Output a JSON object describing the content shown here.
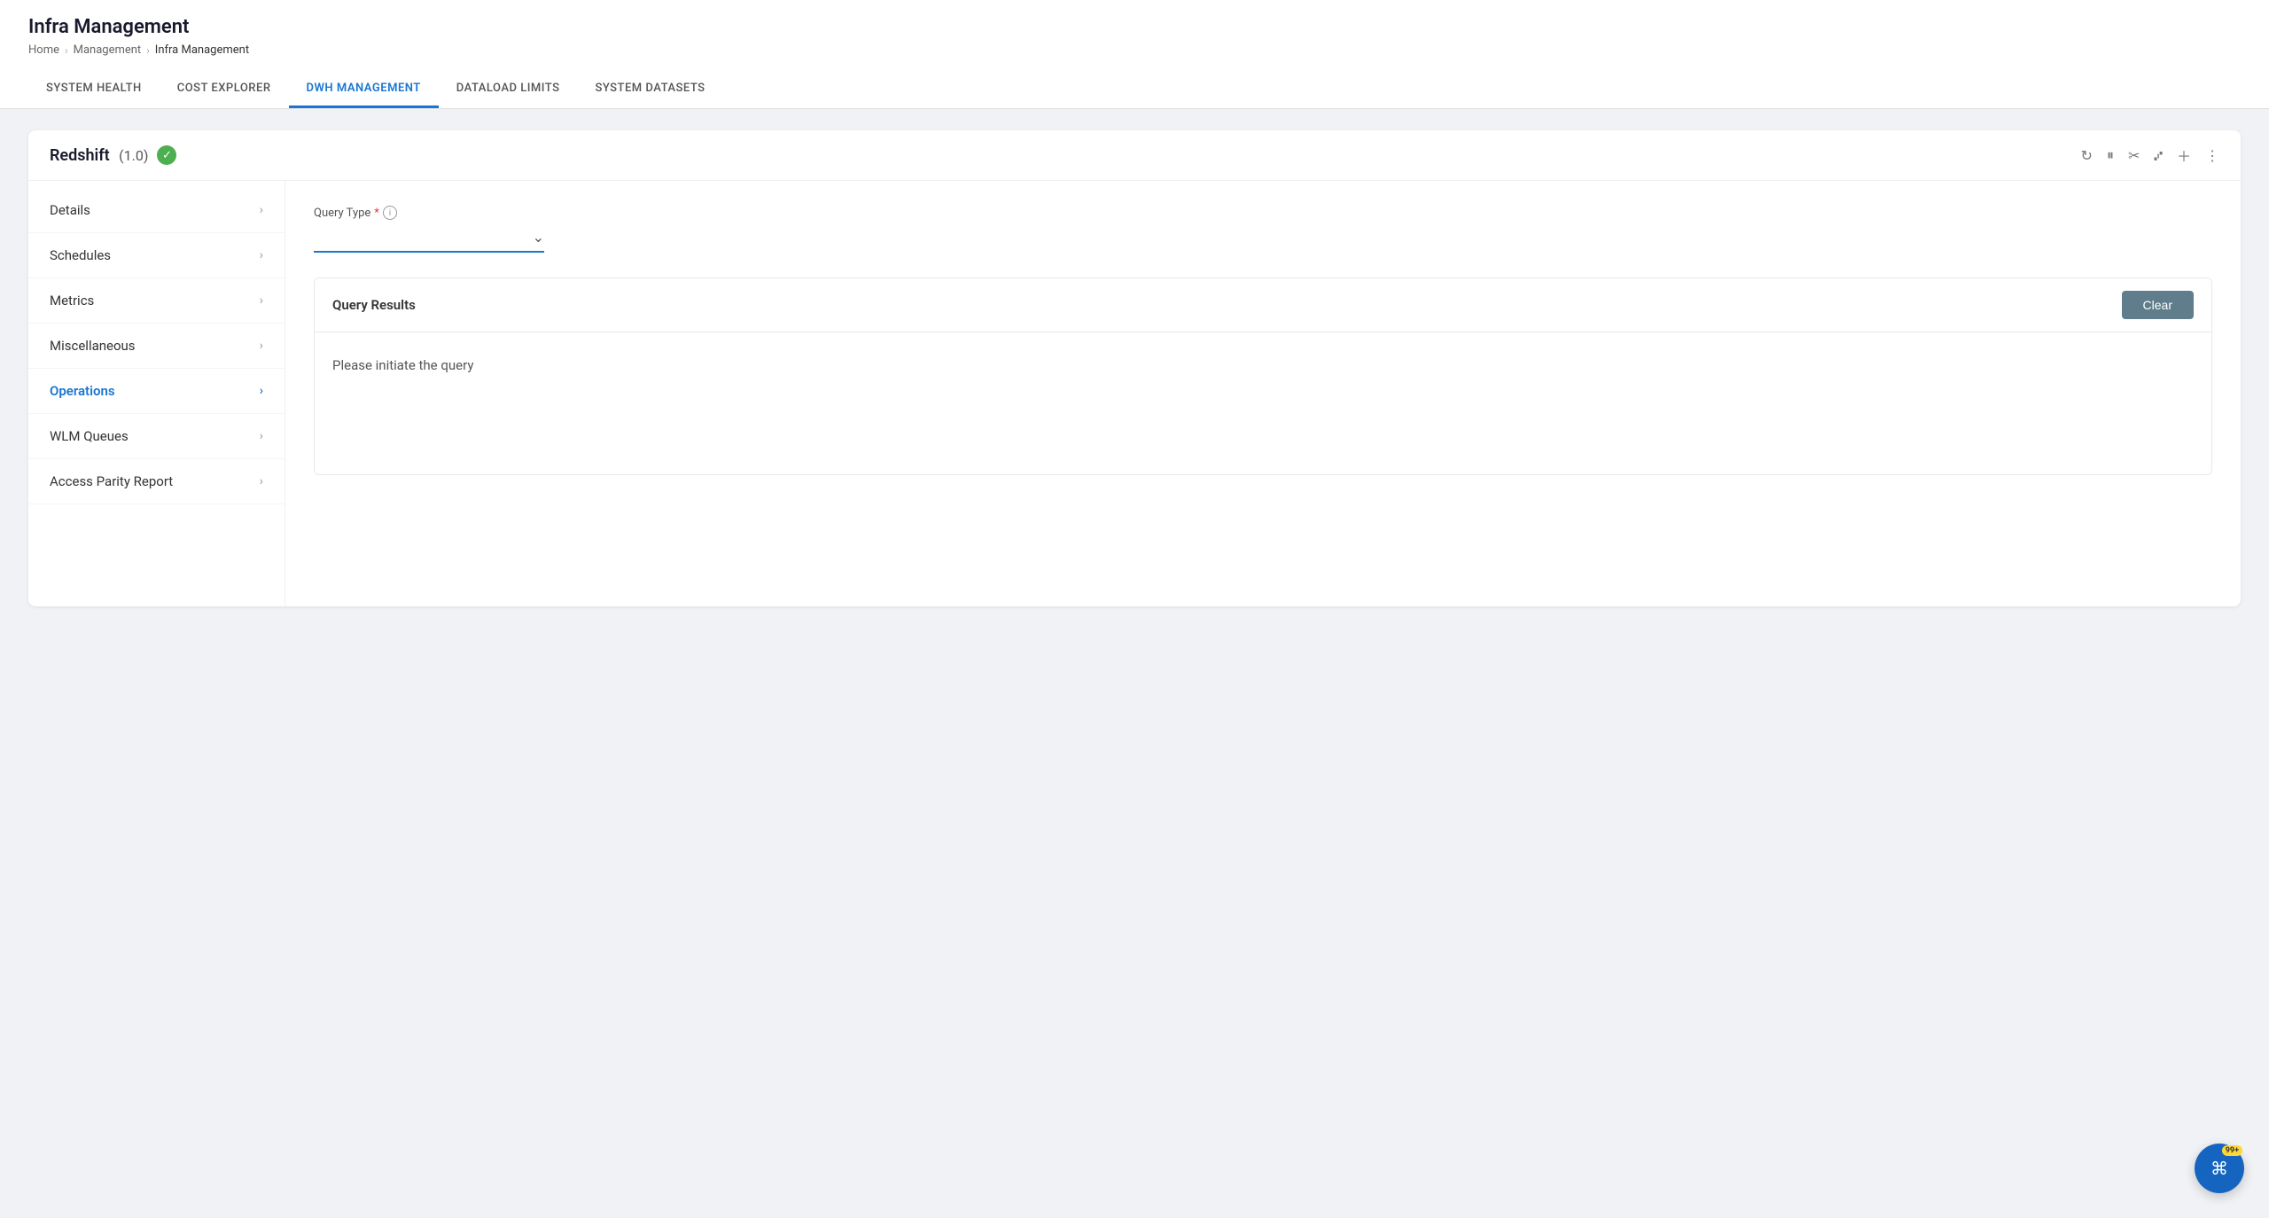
{
  "header": {
    "title": "Infra Management",
    "breadcrumb": {
      "home": "Home",
      "management": "Management",
      "current": "Infra Management"
    }
  },
  "nav": {
    "tabs": [
      {
        "id": "system-health",
        "label": "SYSTEM HEALTH",
        "active": false
      },
      {
        "id": "cost-explorer",
        "label": "COST EXPLORER",
        "active": false
      },
      {
        "id": "dwh-management",
        "label": "DWH MANAGEMENT",
        "active": true
      },
      {
        "id": "dataload-limits",
        "label": "DATALOAD LIMITS",
        "active": false
      },
      {
        "id": "system-datasets",
        "label": "SYSTEM DATASETS",
        "active": false
      }
    ]
  },
  "card": {
    "title": "Redshift",
    "version": "(1.0)",
    "status": "healthy",
    "status_icon": "✓"
  },
  "sidebar": {
    "items": [
      {
        "id": "details",
        "label": "Details",
        "active": false
      },
      {
        "id": "schedules",
        "label": "Schedules",
        "active": false
      },
      {
        "id": "metrics",
        "label": "Metrics",
        "active": false
      },
      {
        "id": "miscellaneous",
        "label": "Miscellaneous",
        "active": false
      },
      {
        "id": "operations",
        "label": "Operations",
        "active": true
      },
      {
        "id": "wlm-queues",
        "label": "WLM Queues",
        "active": false
      },
      {
        "id": "access-parity-report",
        "label": "Access Parity Report",
        "active": false
      }
    ]
  },
  "operations": {
    "query_type": {
      "label": "Query Type",
      "required": true,
      "placeholder": ""
    },
    "query_results": {
      "title": "Query Results",
      "clear_label": "Clear",
      "empty_message": "Please initiate the query"
    }
  },
  "notification": {
    "count": "99+"
  }
}
